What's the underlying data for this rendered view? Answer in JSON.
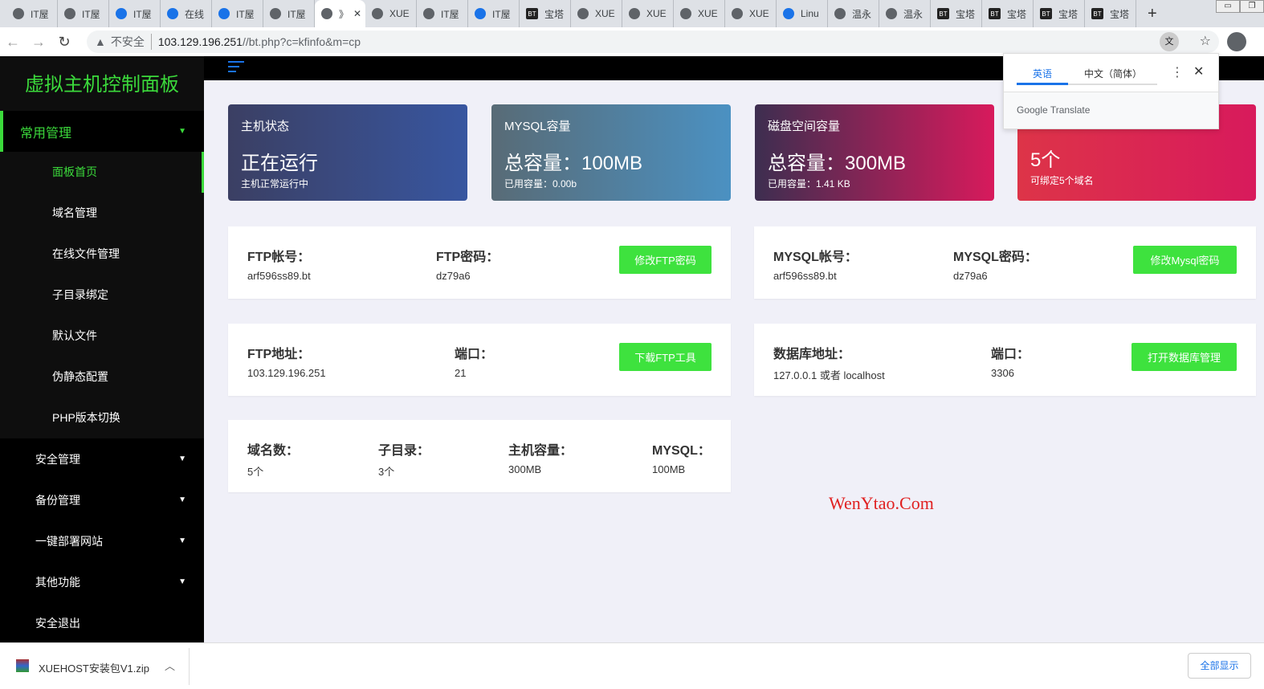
{
  "browser": {
    "tabs": [
      {
        "t": "IT屋",
        "i": "globe"
      },
      {
        "t": "IT屋",
        "i": "globe"
      },
      {
        "t": "IT屋",
        "i": "blue"
      },
      {
        "t": "在线",
        "i": "blue"
      },
      {
        "t": "IT屋",
        "i": "blue"
      },
      {
        "t": "IT屋",
        "i": "globe"
      },
      {
        "t": "》",
        "i": "globe",
        "active": true
      },
      {
        "t": "XUE",
        "i": "globe"
      },
      {
        "t": "IT屋",
        "i": "globe"
      },
      {
        "t": "IT屋",
        "i": "blue"
      },
      {
        "t": "宝塔",
        "i": "bt"
      },
      {
        "t": "XUE",
        "i": "globe"
      },
      {
        "t": "XUE",
        "i": "globe"
      },
      {
        "t": "XUE",
        "i": "globe"
      },
      {
        "t": "XUE",
        "i": "globe"
      },
      {
        "t": "Linu",
        "i": "blue"
      },
      {
        "t": "温永",
        "i": "globe"
      },
      {
        "t": "温永",
        "i": "globe"
      },
      {
        "t": "宝塔",
        "i": "bt"
      },
      {
        "t": "宝塔",
        "i": "bt"
      },
      {
        "t": "宝塔",
        "i": "bt"
      },
      {
        "t": "宝塔",
        "i": "bt"
      }
    ],
    "insecure": "不安全",
    "url_host": "103.129.196.251",
    "url_path": "//bt.php?c=kfinfo&m=cp"
  },
  "translate": {
    "lang1": "英语",
    "lang2": "中文（简体）",
    "footer": "Google Translate",
    "accent": "#1a73e8"
  },
  "sidebar": {
    "title": "虚拟主机控制面板",
    "open_group": "常用管理",
    "sub_items": [
      "面板首页",
      "域名管理",
      "在线文件管理",
      "子目录绑定",
      "默认文件",
      "伪静态配置",
      "PHP版本切换"
    ],
    "groups": [
      "安全管理",
      "备份管理",
      "一键部署网站",
      "其他功能"
    ],
    "logout": "安全退出",
    "accent": "#3bd93b"
  },
  "cards": [
    {
      "title": "主机状态",
      "value": "正在运行",
      "sub": "主机正常运行中"
    },
    {
      "title": "MYSQL容量",
      "value": "总容量：100MB",
      "sub": "已用容量：0.00b"
    },
    {
      "title": "磁盘空间容量",
      "value": "总容量：300MB",
      "sub": "已用容量：1.41 KB"
    },
    {
      "title": "",
      "value": "5个",
      "sub": "可绑定5个域名"
    }
  ],
  "ftp": {
    "user_label": "FTP帐号：",
    "user": "arf596ss89.bt",
    "pass_label": "FTP密码：",
    "pass": "dz79a6",
    "btn": "修改FTP密码",
    "addr_label": "FTP地址：",
    "addr": "103.129.196.251",
    "port_label": "端口：",
    "port": "21",
    "tool_btn": "下载FTP工具"
  },
  "mysql": {
    "user_label": "MYSQL帐号：",
    "user": "arf596ss89.bt",
    "pass_label": "MYSQL密码：",
    "pass": "dz79a6",
    "btn": "修改Mysql密码",
    "addr_label": "数据库地址：",
    "addr": "127.0.0.1 或者 localhost",
    "port_label": "端口：",
    "port": "3306",
    "db_btn": "打开数据库管理"
  },
  "summary": [
    {
      "l": "域名数：",
      "v": "5个"
    },
    {
      "l": "子目录：",
      "v": "3个"
    },
    {
      "l": "主机容量：",
      "v": "300MB"
    },
    {
      "l": "MYSQL：",
      "v": "100MB"
    }
  ],
  "watermark": "WenYtao.Com",
  "download": {
    "file": "XUEHOST安装包V1.zip",
    "show_all": "全部显示"
  }
}
